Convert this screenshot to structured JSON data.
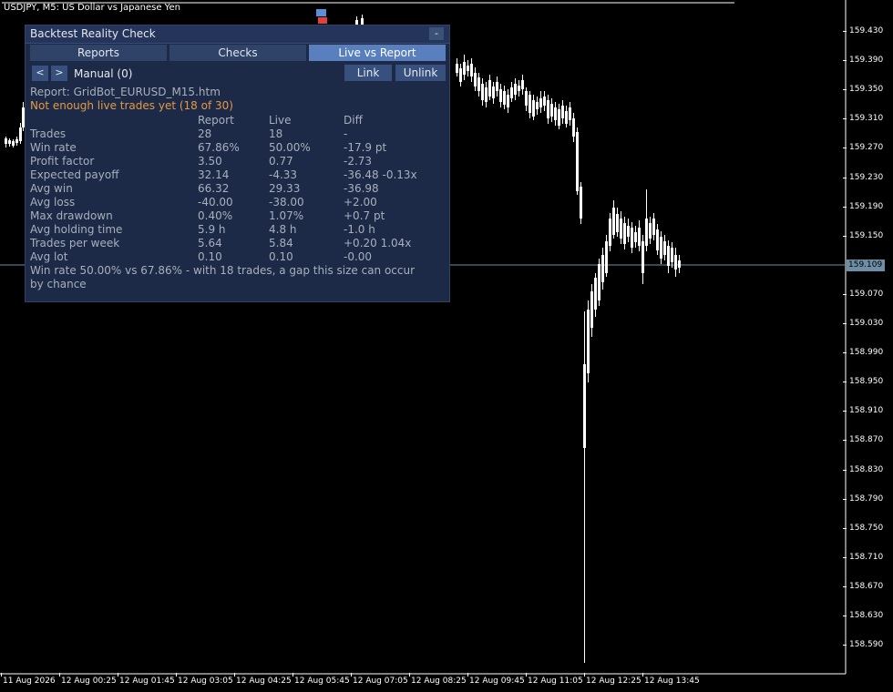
{
  "chart": {
    "symbol_label": "USDJPY, M5:  US Dollar vs Japanese Yen",
    "current_price": "159.109",
    "price_ticks": [
      "159.430",
      "159.390",
      "159.350",
      "159.310",
      "159.270",
      "159.230",
      "159.190",
      "159.150",
      "159.070",
      "159.030",
      "158.990",
      "158.950",
      "158.910",
      "158.870",
      "158.830",
      "158.790",
      "158.750",
      "158.710",
      "158.670",
      "158.630",
      "158.590"
    ],
    "time_ticks": [
      "11 Aug 2026",
      "12 Aug 00:25",
      "12 Aug 01:45",
      "12 Aug 03:05",
      "12 Aug 04:25",
      "12 Aug 05:45",
      "12 Aug 07:05",
      "12 Aug 08:25",
      "12 Aug 09:45",
      "12 Aug 11:05",
      "12 Aug 12:25",
      "12 Aug 13:45"
    ],
    "colors": {
      "bull": "#00e000",
      "bear": "#ffffff",
      "price_line": "#6e8ea6",
      "background": "#000000"
    }
  },
  "panel": {
    "title": "Backtest Reality Check",
    "minimize_label": "-",
    "tabs": [
      {
        "label": "Reports",
        "active": false
      },
      {
        "label": "Checks",
        "active": false
      },
      {
        "label": "Live vs Report",
        "active": true
      }
    ],
    "prev_label": "<",
    "next_label": ">",
    "source_label": "Manual (0)",
    "link_label": "Link",
    "unlink_label": "Unlink",
    "report_name": "Report: GridBot_EURUSD_M15.htm",
    "warning": "Not enough live trades yet (18 of 30)",
    "columns": {
      "report": "Report",
      "live": "Live",
      "diff": "Diff"
    },
    "rows": [
      {
        "metric": "Trades",
        "report": "28",
        "live": "18",
        "diff": "-"
      },
      {
        "metric": "Win rate",
        "report": "67.86%",
        "live": "50.00%",
        "diff": "-17.9 pt"
      },
      {
        "metric": "Profit factor",
        "report": "3.50",
        "live": "0.77",
        "diff": "-2.73"
      },
      {
        "metric": "Expected payoff",
        "report": "32.14",
        "live": "-4.33",
        "diff": "-36.48  -0.13x"
      },
      {
        "metric": "Avg win",
        "report": "66.32",
        "live": "29.33",
        "diff": "-36.98"
      },
      {
        "metric": "Avg loss",
        "report": "-40.00",
        "live": "-38.00",
        "diff": "+2.00"
      },
      {
        "metric": "Max drawdown",
        "report": "0.40%",
        "live": "1.07%",
        "diff": "+0.7 pt"
      },
      {
        "metric": "Avg holding time",
        "report": "5.9 h",
        "live": "4.8 h",
        "diff": "-1.0 h"
      },
      {
        "metric": "Trades per week",
        "report": "5.64",
        "live": "5.84",
        "diff": "+0.20  1.04x"
      },
      {
        "metric": "Avg lot",
        "report": "0.10",
        "live": "0.10",
        "diff": "-0.00"
      }
    ],
    "note": "Win rate 50.00% vs 67.86% - with 18 trades, a gap this size can occur by chance"
  }
}
